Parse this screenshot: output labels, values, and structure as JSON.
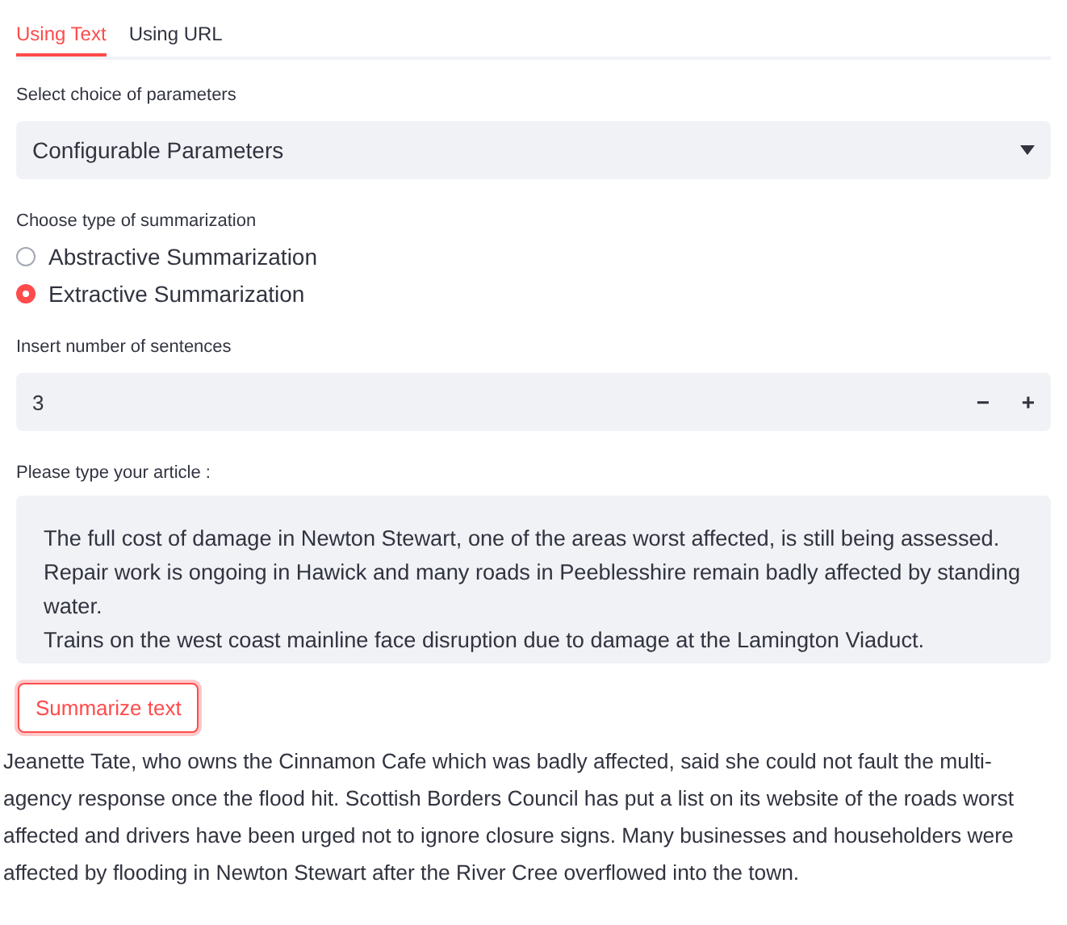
{
  "tabs": [
    {
      "label": "Using Text",
      "selected": true
    },
    {
      "label": "Using URL",
      "selected": false
    }
  ],
  "parameters": {
    "label": "Select choice of parameters",
    "value": "Configurable Parameters"
  },
  "summarization": {
    "label": "Choose type of summarization",
    "options": [
      {
        "label": "Abstractive Summarization",
        "selected": false
      },
      {
        "label": "Extractive Summarization",
        "selected": true
      }
    ]
  },
  "sentences": {
    "label": "Insert number of sentences",
    "value": "3",
    "minus": "−",
    "plus": "+"
  },
  "article": {
    "label": "Please type your article :",
    "value": "The full cost of damage in Newton Stewart, one of the areas worst affected, is still being assessed.\nRepair work is ongoing in Hawick and many roads in Peeblesshire remain badly affected by standing water.\nTrains on the west coast mainline face disruption due to damage at the Lamington Viaduct."
  },
  "button": "Summarize text",
  "summary": "Jeanette Tate, who owns the Cinnamon Cafe which was badly affected, said she could not fault the multi-agency response once the flood hit. Scottish Borders Council has put a list on its website of the roads worst affected and drivers have been urged not to ignore closure signs. Many businesses and householders were affected by flooding in Newton Stewart after the River Cree overflowed into the town."
}
